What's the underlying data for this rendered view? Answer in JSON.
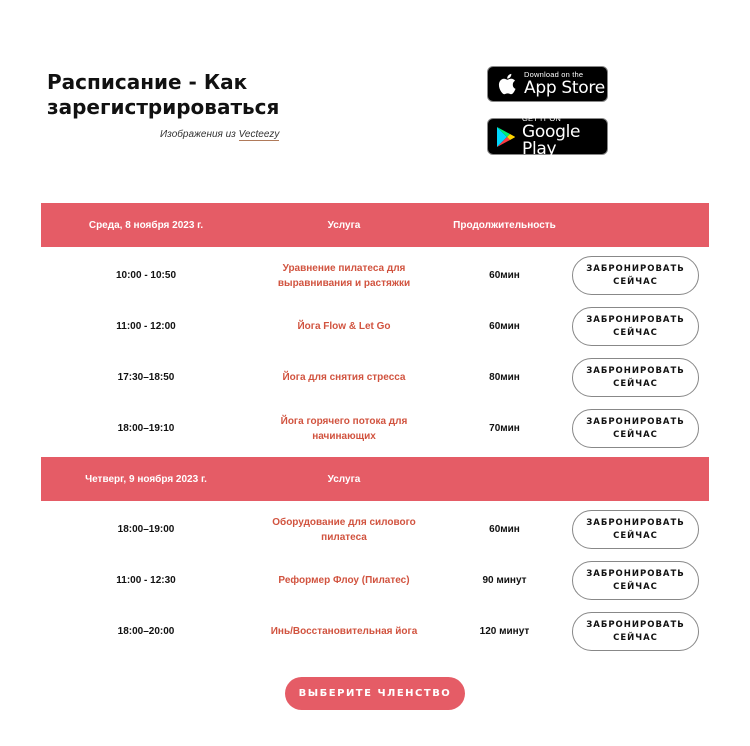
{
  "header": {
    "title": "Расписание - Как зарегистрироваться",
    "credit_prefix": "Изображения из",
    "credit_link": "Vecteezy"
  },
  "stores": {
    "apple": {
      "small": "Download on the",
      "big": "App Store",
      "icon": "apple-icon"
    },
    "google": {
      "small": "GET IT ON",
      "big": "Google Play",
      "icon": "google-play-icon"
    }
  },
  "colors": {
    "accent": "#e55c66",
    "service_text": "#d1533f"
  },
  "days": [
    {
      "date": "Среда, 8 ноября 2023 г.",
      "service_header": "Услуга",
      "duration_header": "Продолжительность",
      "sessions": [
        {
          "time": "10:00 - 10:50",
          "service": "Уравнение пилатеса для выравнивания и растяжки",
          "duration": "60мин",
          "action": "ЗАБРОНИРОВАТЬ СЕЙЧАС"
        },
        {
          "time": "11:00 - 12:00",
          "service": "Йога Flow & Let Go",
          "duration": "60мин",
          "action": "ЗАБРОНИРОВАТЬ СЕЙЧАС"
        },
        {
          "time": "17:30–18:50",
          "service": "Йога для снятия стресса",
          "duration": "80мин",
          "action": "ЗАБРОНИРОВАТЬ СЕЙЧАС"
        },
        {
          "time": "18:00–19:10",
          "service": "Йога горячего потока для начинающих",
          "duration": "70мин",
          "action": "ЗАБРОНИРОВАТЬ СЕЙЧАС"
        }
      ]
    },
    {
      "date": "Четверг, 9 ноября 2023 г.",
      "service_header": "Услуга",
      "duration_header": "",
      "sessions": [
        {
          "time": "18:00–19:00",
          "service": "Оборудование для силового пилатеса",
          "duration": "60мин",
          "action": "ЗАБРОНИРОВАТЬ СЕЙЧАС"
        },
        {
          "time": "11:00 - 12:30",
          "service": "Реформер Флоу (Пилатес)",
          "duration": "90 минут",
          "action": "ЗАБРОНИРОВАТЬ СЕЙЧАС"
        },
        {
          "time": "18:00–20:00",
          "service": "Инь/Восстановительная йога",
          "duration": "120 минут",
          "action": "ЗАБРОНИРОВАТЬ СЕЙЧАС"
        }
      ]
    }
  ],
  "footer": {
    "membership_label": "ВЫБЕРИТЕ ЧЛЕНСТВО"
  }
}
